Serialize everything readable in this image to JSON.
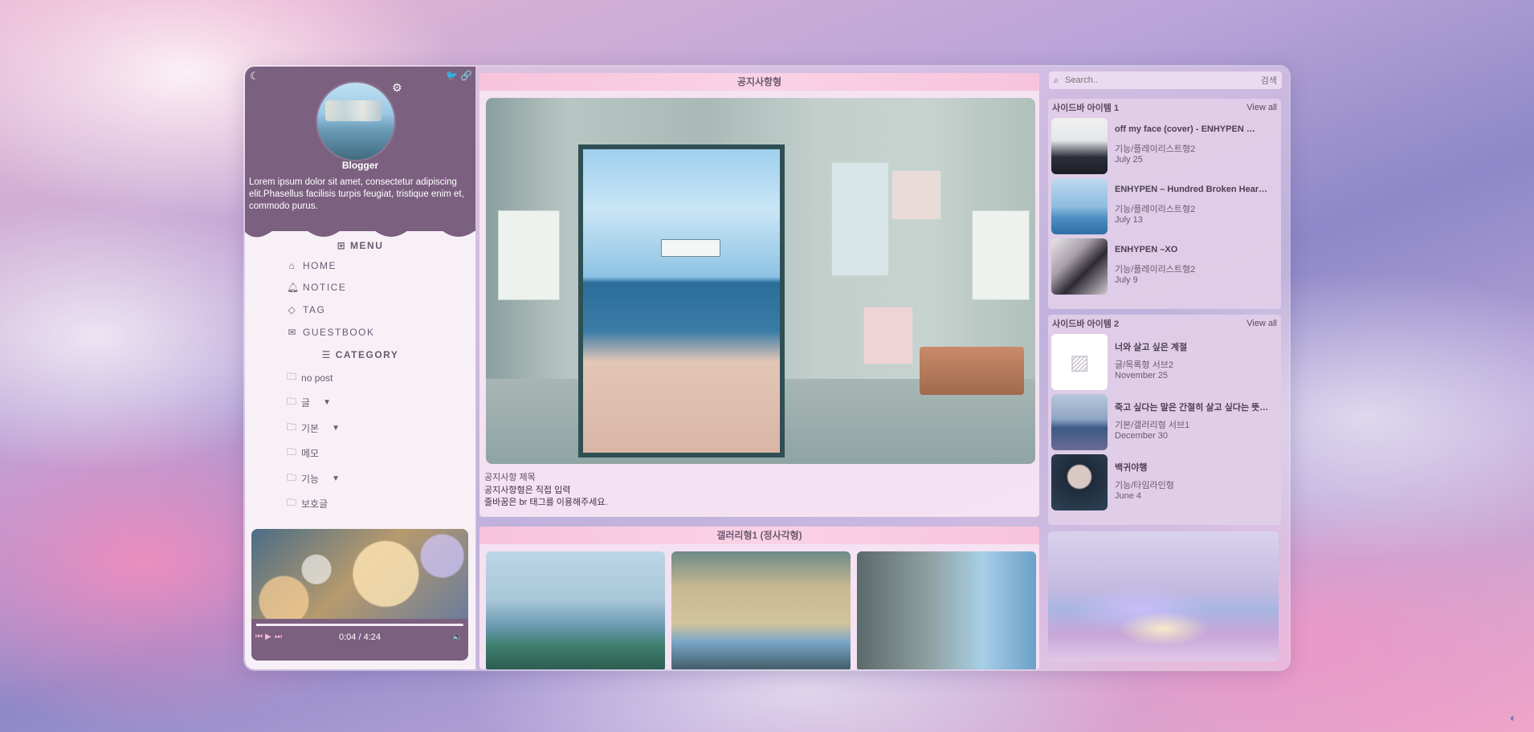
{
  "profile": {
    "blog_name": "Blogger",
    "bio": "Lorem ipsum dolor sit amet, consectetur adipiscing elit.Phasellus facilisis turpis feugiat, tristique enim et, commodo purus.",
    "icons": {
      "theme": "moon-icon",
      "twitter": "twitter-icon",
      "link": "link-icon",
      "settings": "gear-icon"
    }
  },
  "menu": {
    "title": "MENU",
    "items": [
      {
        "label": "HOME",
        "icon": "home-icon"
      },
      {
        "label": "NOTICE",
        "icon": "bell-icon"
      },
      {
        "label": "TAG",
        "icon": "tag-icon"
      },
      {
        "label": "GUESTBOOK",
        "icon": "mail-icon"
      }
    ]
  },
  "category": {
    "title": "CATEGORY",
    "items": [
      {
        "label": "no post",
        "has_children": false
      },
      {
        "label": "글",
        "has_children": true
      },
      {
        "label": "기본",
        "has_children": true
      },
      {
        "label": "메모",
        "has_children": false
      },
      {
        "label": "기능",
        "has_children": true
      },
      {
        "label": "보호글",
        "has_children": false
      }
    ]
  },
  "player": {
    "time": "0:04 / 4:24",
    "progress": 0.015
  },
  "notice": {
    "header": "공지사항형",
    "title": "공지사항 제목",
    "body_line1": "공지사항형은 직접 입력",
    "body_line2": "줄바꿈은 br 태그를 이용해주세요."
  },
  "gallery": {
    "header": "갤러리형1 (정사각형)"
  },
  "search": {
    "placeholder": "Search..",
    "button": "검색"
  },
  "widget1": {
    "title": "사이드바 아이템 1",
    "view_all": "View all",
    "items": [
      {
        "title": "off my face (cover) - ENHYPEN …",
        "category": "기능/플레이리스트형2",
        "date": "July 25"
      },
      {
        "title": "ENHYPEN – Hundred Broken Hear…",
        "category": "기능/플레이리스트형2",
        "date": "July 13"
      },
      {
        "title": "ENHYPEN –XO",
        "category": "기능/플레이리스트형2",
        "date": "July 9"
      }
    ]
  },
  "widget2": {
    "title": "사이드바 아이템 2",
    "view_all": "View all",
    "items": [
      {
        "title": "너와 살고 싶은 계절",
        "category": "글/목록형 서브2",
        "date": "November 25"
      },
      {
        "title": "죽고 싶다는 말은 간절히 살고 싶다는 뜻…",
        "category": "기본/갤러리형 서브1",
        "date": "December 30"
      },
      {
        "title": "백귀야행",
        "category": "기능/타임라인형",
        "date": "June 4"
      }
    ]
  },
  "colors": {
    "sidebar_bg": "#7c6080",
    "accent_pink": "#f7c3dc",
    "text_muted": "#6b5a70"
  }
}
